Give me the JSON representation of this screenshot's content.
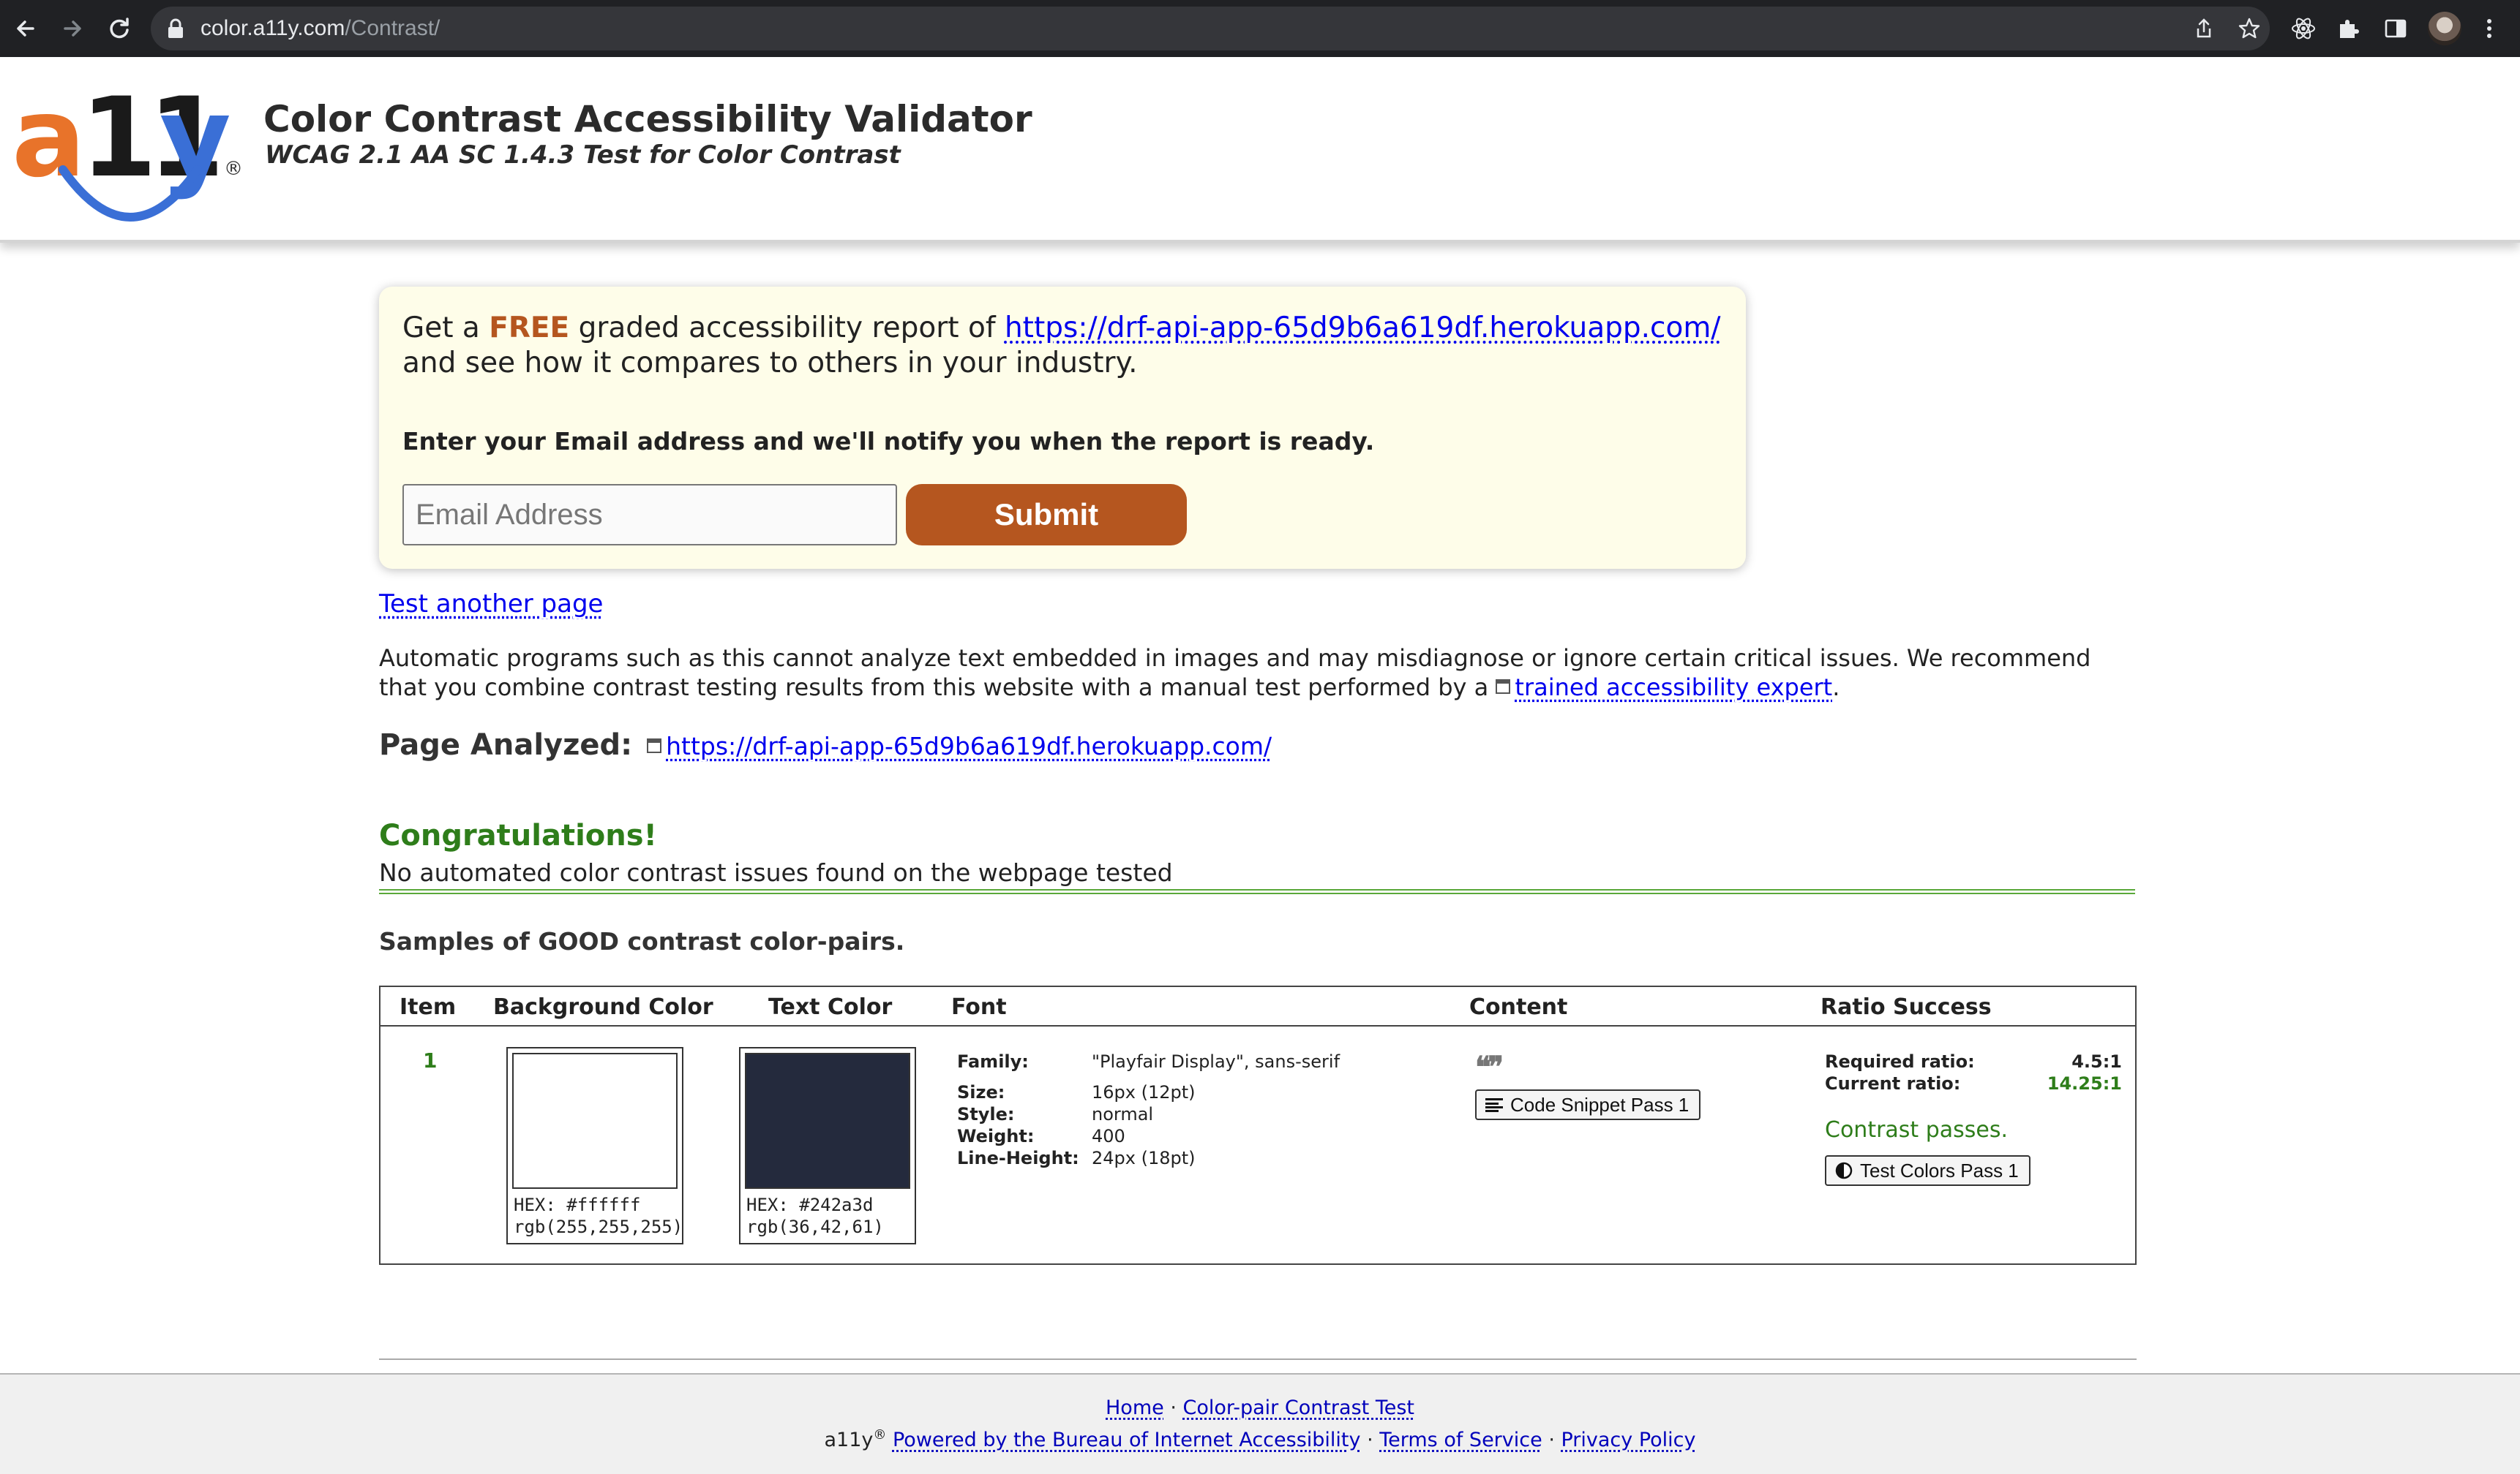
{
  "browser": {
    "url_host": "color.a11y.com",
    "url_path": "/Contrast/"
  },
  "header": {
    "logo_a": "a",
    "logo_11": "11",
    "logo_y": "y",
    "logo_reg": "®",
    "title": "Color Contrast Accessibility Validator",
    "subtitle": "WCAG 2.1 AA SC 1.4.3 Test for Color Contrast"
  },
  "report_box": {
    "line1_prefix": "Get a ",
    "line1_free": "FREE",
    "line1_middle": " graded accessibility report of ",
    "site_url": "https://drf-api-app-65d9b6a619df.herokuapp.com/",
    "line2": "and see how it compares to others in your industry.",
    "notify_text": "Enter your Email address and we'll notify you when the report is ready.",
    "email_placeholder": "Email Address",
    "submit_label": "Submit"
  },
  "body": {
    "test_another": "Test another page",
    "para_text": "Automatic programs such as this cannot analyze text embedded in images and may misdiagnose or ignore certain critical issues. We recommend that you combine contrast testing results from this website with a manual test performed by a ",
    "expert_link": "trained accessibility expert",
    "para_end": ".",
    "page_analyzed_label": "Page Analyzed:",
    "page_analyzed_url": "https://drf-api-app-65d9b6a619df.herokuapp.com/",
    "congrats_title": "Congratulations!",
    "congrats_text": "No automated color contrast issues found on the webpage tested",
    "samples_title": "Samples of GOOD contrast color-pairs."
  },
  "table": {
    "headers": {
      "item": "Item",
      "background": "Background Color",
      "text": "Text Color",
      "font": "Font",
      "content": "Content",
      "ratio": "Ratio Success"
    },
    "rows": [
      {
        "item": "1",
        "bg_color": "#ffffff",
        "bg_hex": "HEX: #ffffff",
        "bg_rgb": "rgb(255,255,255)",
        "text_color": "#242a3d",
        "text_hex": "HEX: #242a3d",
        "text_rgb": "rgb(36,42,61)",
        "font": {
          "family_label": "Family:",
          "family": "\"Playfair Display\", sans-serif",
          "size_label": "Size:",
          "size": "16px (12pt)",
          "style_label": "Style:",
          "style": "normal",
          "weight_label": "Weight:",
          "weight": "400",
          "line_height_label": "Line-Height:",
          "line_height": "24px (18pt)"
        },
        "quote_icon": "quote-icon",
        "snippet_button": "Code Snippet Pass 1",
        "required_label": "Required ratio:",
        "required": "4.5:1",
        "current_label": "Current ratio:",
        "current": "14.25:1",
        "current_color": "#2e7d1a",
        "passes_text": "Contrast passes.",
        "test_colors_button": "Test Colors Pass 1"
      }
    ]
  },
  "footer": {
    "home": "Home",
    "sep": " · ",
    "contrast_test": "Color-pair Contrast Test",
    "brand": "a11y",
    "brand_reg": "®",
    "powered": "Powered by the Bureau of Internet Accessibility",
    "terms": "Terms of Service",
    "privacy": "Privacy Policy"
  },
  "colors": {
    "accent_orange": "#b5561f",
    "success_green": "#2e7d1a",
    "logo_blue": "#3a6fd6",
    "logo_orange": "#e8732a"
  }
}
